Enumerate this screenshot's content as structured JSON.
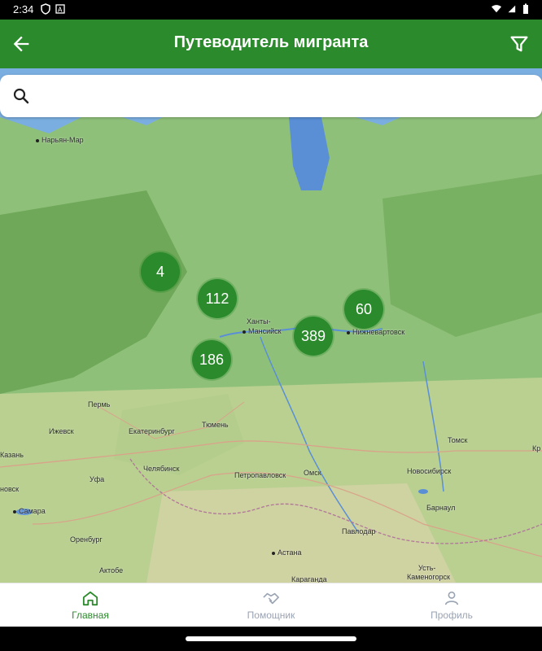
{
  "status_bar": {
    "time": "2:34"
  },
  "app_bar": {
    "title": "Путеводитель мигранта"
  },
  "search": {
    "value": "",
    "placeholder": ""
  },
  "clusters": [
    {
      "count": "4"
    },
    {
      "count": "112"
    },
    {
      "count": "60"
    },
    {
      "count": "389"
    },
    {
      "count": "186"
    }
  ],
  "cities": {
    "naryan_mar": "Нарьян-Мар",
    "khanty_1": "Ханты-",
    "khanty_2": "Мансийск",
    "nizhnevartovsk": "Нижневартовск",
    "perm": "Пермь",
    "izhevsk": "Ижевск",
    "ekaterinburg": "Екатеринбург",
    "tyumen": "Тюмень",
    "tomsk": "Томск",
    "kazan": "Казань",
    "ufa": "Уфа",
    "chelyabinsk": "Челябинск",
    "petropavlovsk": "Петропавловск",
    "omsk": "Омск",
    "novosibirsk": "Новосибирск",
    "novgorod": "новск",
    "samara": "Самара",
    "barnaul": "Барнаул",
    "orenburg": "Оренбург",
    "pavlodar": "Павлодар",
    "astana": "Астана",
    "aktobe": "Актобе",
    "karaganda": "Караганда",
    "ust": "Усть-",
    "kamenogorsk": "Каменогорск",
    "kr": "Кр"
  },
  "bottom_nav": {
    "items": [
      {
        "label": "Главная",
        "active": true
      },
      {
        "label": "Помощник",
        "active": false
      },
      {
        "label": "Профиль",
        "active": false
      }
    ]
  },
  "colors": {
    "primary": "#2b8a2b",
    "inactive": "#9aa3b3"
  }
}
